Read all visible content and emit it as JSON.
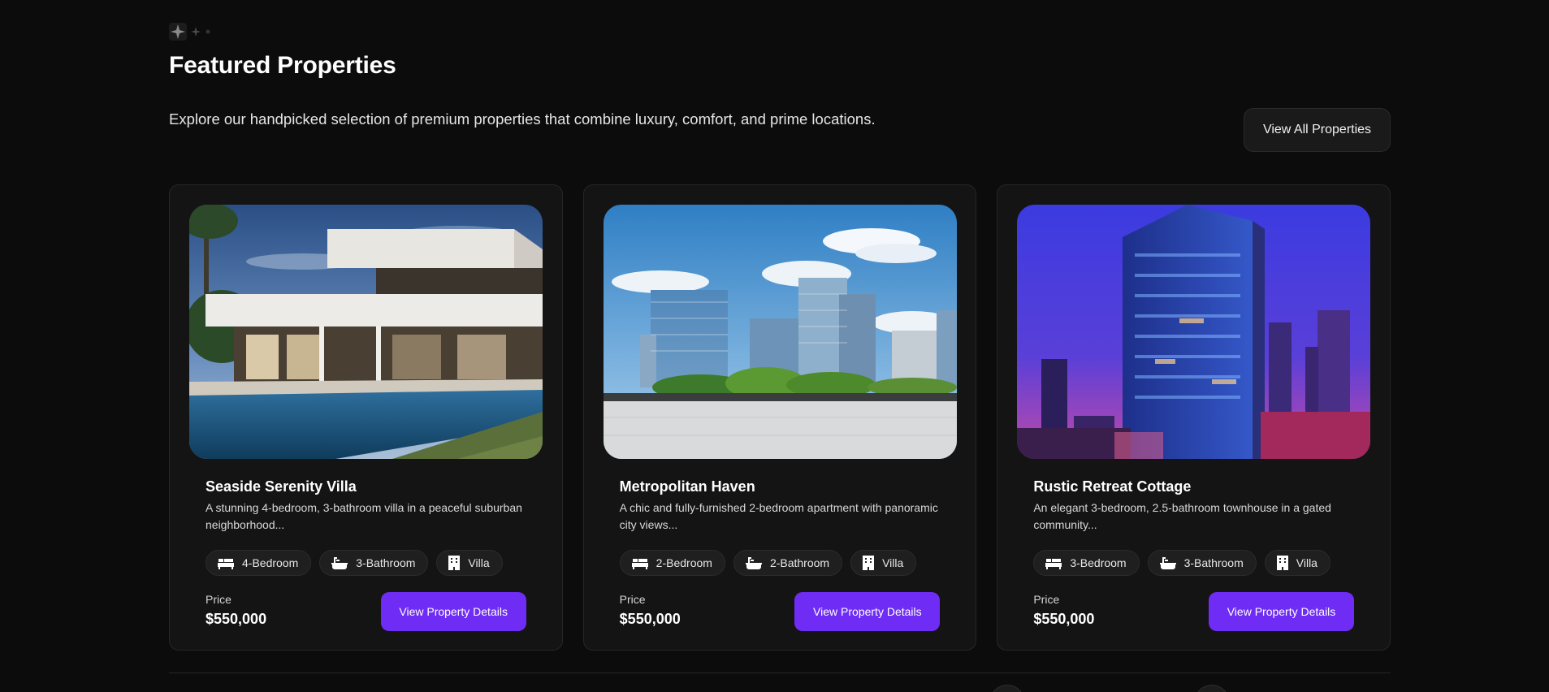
{
  "section": {
    "title": "Featured Properties",
    "subtitle": "Explore our handpicked selection of premium properties that combine luxury, comfort, and prime locations.",
    "view_all_label": "View All Properties"
  },
  "icons": {
    "decor": "sparkle-icon",
    "bedroom": "bed-icon",
    "bathroom": "bathtub-icon",
    "type": "building-icon"
  },
  "colors": {
    "background": "#0c0c0c",
    "card": "#141414",
    "accent": "#6f2cf4"
  },
  "properties": [
    {
      "title": "Seaside Serenity Villa",
      "description": "A stunning 4-bedroom, 3-bathroom villa in a peaceful suburban neighborhood...",
      "bedrooms": "4-Bedroom",
      "bathrooms": "3-Bathroom",
      "type": "Villa",
      "price_label": "Price",
      "price": "$550,000",
      "button_label": "View Property Details"
    },
    {
      "title": "Metropolitan Haven",
      "description": "A chic and fully-furnished 2-bedroom apartment with panoramic city views...",
      "bedrooms": "2-Bedroom",
      "bathrooms": "2-Bathroom",
      "type": "Villa",
      "price_label": "Price",
      "price": "$550,000",
      "button_label": "View Property Details"
    },
    {
      "title": "Rustic Retreat Cottage",
      "description": "An elegant 3-bedroom, 2.5-bathroom townhouse in a gated community...",
      "bedrooms": "3-Bedroom",
      "bathrooms": "3-Bathroom",
      "type": "Villa",
      "price_label": "Price",
      "price": "$550,000",
      "button_label": "View Property Details"
    }
  ]
}
